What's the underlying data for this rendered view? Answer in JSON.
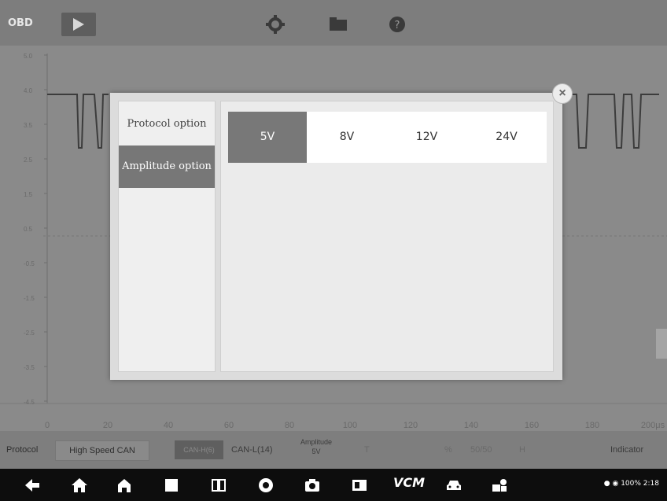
{
  "topbar": {
    "obd_label": "OBD",
    "icons": [
      "play-icon",
      "gear-icon",
      "folder-icon",
      "help-icon"
    ]
  },
  "chart": {
    "y_ticks": [
      "5.0",
      "4.0",
      "3.5",
      "2.5",
      "1.5",
      "0.5",
      "-0.5",
      "-1.5",
      "-2.5",
      "-3.5",
      "-4.5"
    ],
    "x_ticks": [
      "0",
      "20",
      "40",
      "60",
      "80",
      "100",
      "120",
      "140",
      "160",
      "180",
      "200μs"
    ]
  },
  "modal": {
    "side_items": [
      "Protocol option",
      "Amplitude option"
    ],
    "selected_side_item": "Amplitude option",
    "amplitude_options": [
      "5V",
      "8V",
      "12V",
      "24V"
    ],
    "selected_amplitude": "5V"
  },
  "status_row": {
    "protocol_label": "Protocol",
    "protocol_value": "High Speed CAN",
    "can_h": "CAN-H(6)",
    "can_l": "CAN-L(14)",
    "amplitude_label": "Amplitude",
    "amplitude_value": "5V",
    "t_label": "T",
    "percent_label": "%",
    "ratio": "50/50",
    "h_label": "H",
    "indicator_label": "Indicator"
  },
  "navbar": {
    "icons": [
      "back-icon",
      "home-icon",
      "house-icon",
      "square-icon",
      "split-icon",
      "browser-icon",
      "camera-icon",
      "screen-icon",
      "vci-icon",
      "car-icon",
      "shop-icon"
    ],
    "vci_label": "VCM",
    "status_text": "100% 2:18"
  },
  "colors": {
    "selected": "#787878",
    "background_dim": "#8e8e8e",
    "navbar": "#0d0d0d"
  }
}
